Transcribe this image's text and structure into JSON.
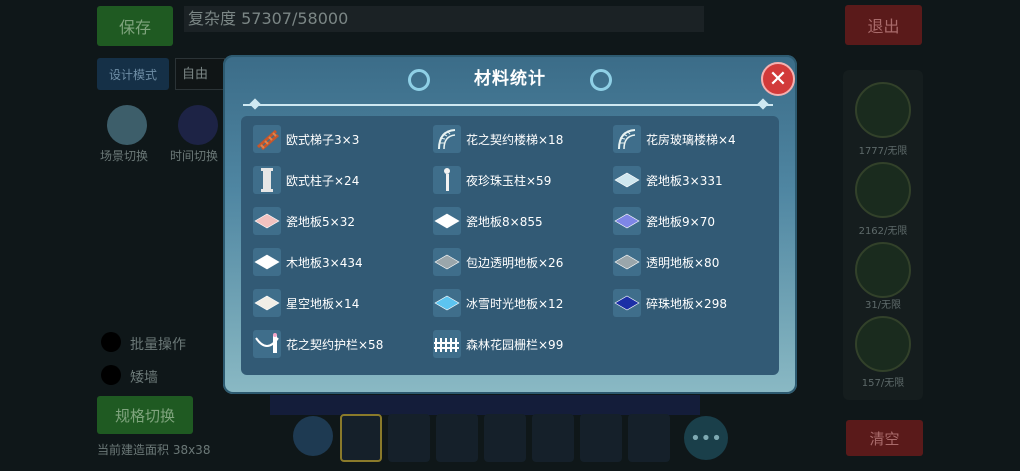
{
  "background": {
    "save_label": "保存",
    "complexity": "复杂度 57307/58000",
    "exit_label": "退出",
    "mode_label": "设计模式",
    "mode_value": "自由",
    "scene_label": "场景切换",
    "time_label": "时间切换",
    "batch_label": "批量操作",
    "wall_label": "矮墙",
    "spec_label": "规格切换",
    "area_text": "当前建造面积 38x38",
    "clear_label": "清空",
    "right_counts": [
      "1777/无限",
      "2162/无限",
      "31/无限",
      "157/无限"
    ],
    "more_label": "•••"
  },
  "modal": {
    "title": "材料统计",
    "close_label": "✕",
    "items": [
      {
        "name": "欧式梯子3×3",
        "icon": "ladder-icon",
        "color": "#c7562a"
      },
      {
        "name": "花之契约楼梯×18",
        "icon": "stairs-icon",
        "color": "#e8f3f2"
      },
      {
        "name": "花房玻璃楼梯×4",
        "icon": "glass-stairs-icon",
        "color": "#e8f3f2"
      },
      {
        "name": "欧式柱子×24",
        "icon": "pillar-icon",
        "color": "#e6e6e6"
      },
      {
        "name": "夜珍珠玉柱×59",
        "icon": "pearl-pillar-icon",
        "color": "#f2f2f2"
      },
      {
        "name": "瓷地板3×331",
        "icon": "tile-icon",
        "color": "#cfe7ef"
      },
      {
        "name": "瓷地板5×32",
        "icon": "tile-icon",
        "color": "#f2c2c0"
      },
      {
        "name": "瓷地板8×855",
        "icon": "tile-icon",
        "color": "#ffffff"
      },
      {
        "name": "瓷地板9×70",
        "icon": "tile-icon",
        "color": "#7e86e6"
      },
      {
        "name": "木地板3×434",
        "icon": "tile-icon",
        "color": "#ffffff"
      },
      {
        "name": "包边透明地板×26",
        "icon": "tile-icon",
        "color": "#9aa6ab"
      },
      {
        "name": "透明地板×80",
        "icon": "tile-icon",
        "color": "#9aa6ab"
      },
      {
        "name": "星空地板×14",
        "icon": "tile-icon",
        "color": "#f2eee6"
      },
      {
        "name": "冰雪时光地板×12",
        "icon": "tile-icon",
        "color": "#5cc4f0"
      },
      {
        "name": "碎珠地板×298",
        "icon": "tile-icon",
        "color": "#1c2fa6"
      },
      {
        "name": "花之契约护栏×58",
        "icon": "railing-icon",
        "color": "#ffffff"
      },
      {
        "name": "森林花园栅栏×99",
        "icon": "fence-icon",
        "color": "#ffffff"
      }
    ]
  }
}
